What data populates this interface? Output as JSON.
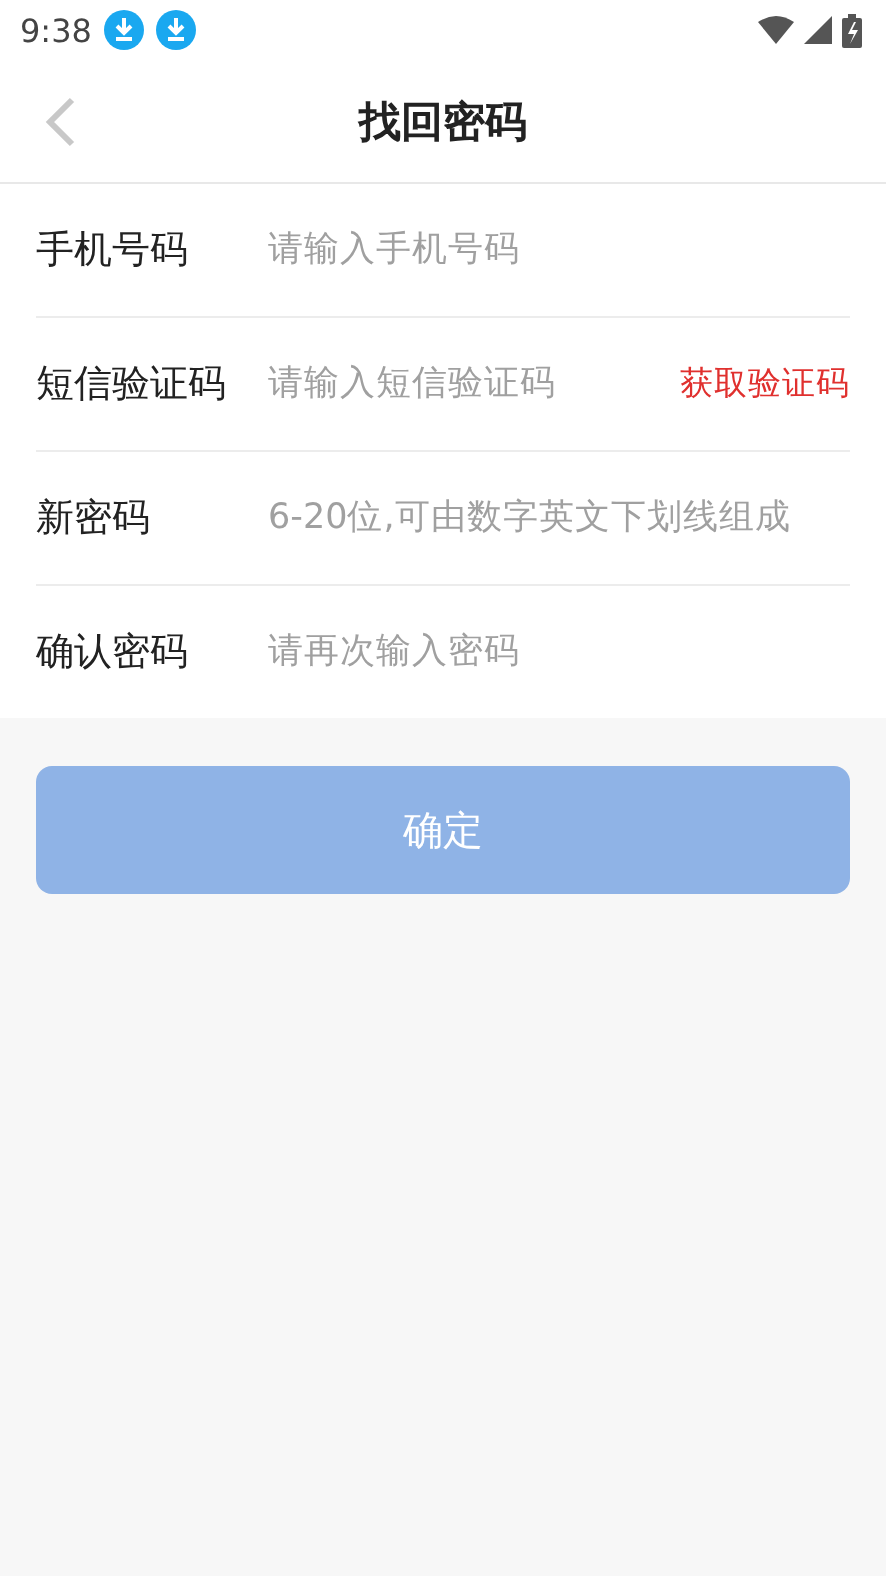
{
  "status_bar": {
    "time": "9:38"
  },
  "header": {
    "title": "找回密码"
  },
  "fields": [
    {
      "label": "手机号码",
      "placeholder": "请输入手机号码"
    },
    {
      "label": "短信验证码",
      "placeholder": "请输入短信验证码",
      "action": "获取验证码"
    },
    {
      "label": "新密码",
      "placeholder": "6-20位,可由数字英文下划线组成"
    },
    {
      "label": "确认密码",
      "placeholder": "请再次输入密码"
    }
  ],
  "submit": {
    "label": "确定",
    "disabled": true
  }
}
